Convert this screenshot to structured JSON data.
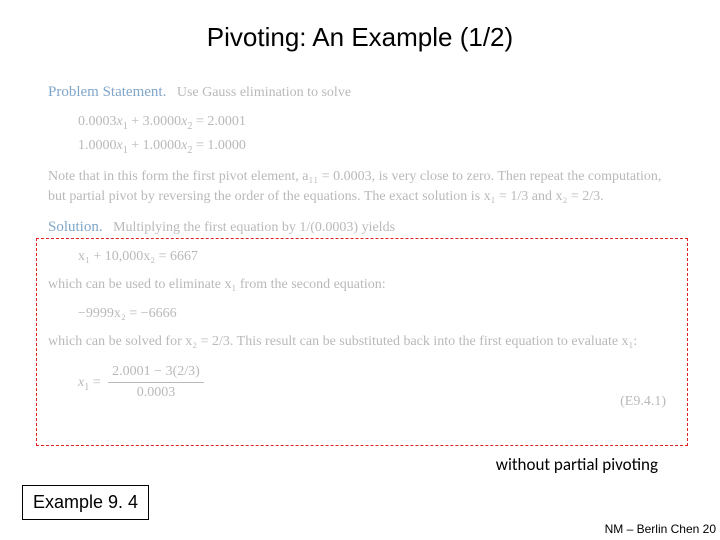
{
  "title": "Pivoting: An Example (1/2)",
  "problem": {
    "heading": "Problem Statement.",
    "intro": "Use Gauss elimination to solve",
    "eq1_lhs_a": "0.0003",
    "eq1_lhs_b": "3.0000",
    "eq1_rhs": "2.0001",
    "eq2_lhs_a": "1.0000",
    "eq2_lhs_b": "1.0000",
    "eq2_rhs": "1.0000",
    "note": "Note that in this form the first pivot element, a₁₁ = 0.0003, is very close to zero. Then repeat the computation, but partial pivot by reversing the order of the equations. The exact solution is x₁ = 1/3 and x₂ = 2/3."
  },
  "solution": {
    "heading": "Solution.",
    "intro": "Multiplying the first equation by 1/(0.0003) yields",
    "eq3": "x₁ + 10,000x₂ = 6667",
    "line2": "which can be used to eliminate x₁ from the second equation:",
    "eq4": "−9999x₂ = −6666",
    "line3": "which can be solved for x₂ = 2/3. This result can be substituted back into the first equation to evaluate x₁:",
    "frac_num": "2.0001 − 3(2/3)",
    "frac_den": "0.0003",
    "eqtag": "(E9.4.1)"
  },
  "caption": "without partial pivoting",
  "example_label": "Example 9. 4",
  "footer": "NM – Berlin Chen 20"
}
